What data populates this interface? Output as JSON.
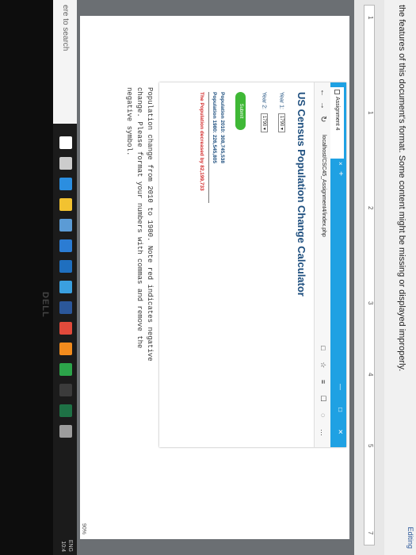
{
  "word": {
    "status": "Editing",
    "warning": "the features of this document's format. Some content might be missing or displayed improperly.",
    "ruler_ticks": [
      "1",
      "1",
      "2",
      "3",
      "4",
      "5",
      "7"
    ],
    "zoom": "90%",
    "instructions": [
      "Population change from 2010 to 1980. Note red indicates negative",
      "change. Please format your numbers with commas and remove the",
      "negative symbol."
    ]
  },
  "browser": {
    "tab_title": "Assignment 4",
    "tab_close": "×",
    "tab_new": "+",
    "window_controls": "— □ ✕",
    "url": "localhost/CSC45_Assignment4/index.php",
    "back": "←",
    "forward": "→",
    "refresh": "↻",
    "toolbar_icons": "□ ☆ ≡ ☐ ◌ …",
    "page": {
      "title": "US Census Population Change Calculator",
      "year1_label": "Year 1:",
      "year1_value": "1790 ▾",
      "year2_label": "Year 2:",
      "year2_value": "1790 ▾",
      "submit_label": "Submit",
      "pop_2010": "Population 2010: 308,745,538",
      "pop_1980": "Population 1980: 226,545,805",
      "result": "The Population decreased by 82,199,733"
    }
  },
  "taskbar": {
    "search_placeholder": "ere to search",
    "tray": "ENG\n10:4",
    "brand": "DELL",
    "icons": [
      {
        "name": "cortana-icon",
        "color": "#ffffff"
      },
      {
        "name": "task-view-icon",
        "color": "#cccccc"
      },
      {
        "name": "edge-icon",
        "color": "#2b8ee0"
      },
      {
        "name": "file-explorer-icon",
        "color": "#f2c230"
      },
      {
        "name": "store-icon",
        "color": "#5b9bd5"
      },
      {
        "name": "mail-icon",
        "color": "#2b7cd3"
      },
      {
        "name": "photos-icon",
        "color": "#1f6fbf"
      },
      {
        "name": "windows-icon",
        "color": "#3aa0e0"
      },
      {
        "name": "word-icon",
        "color": "#2b579a"
      },
      {
        "name": "chrome-icon",
        "color": "#e14a3b"
      },
      {
        "name": "firefox-icon",
        "color": "#f28b1d"
      },
      {
        "name": "app-icon",
        "color": "#2ca44a"
      },
      {
        "name": "app2-icon",
        "color": "#3b3b3b"
      },
      {
        "name": "excel-icon",
        "color": "#1e7145"
      },
      {
        "name": "explorer-icon",
        "color": "#9c9c9c"
      }
    ]
  }
}
